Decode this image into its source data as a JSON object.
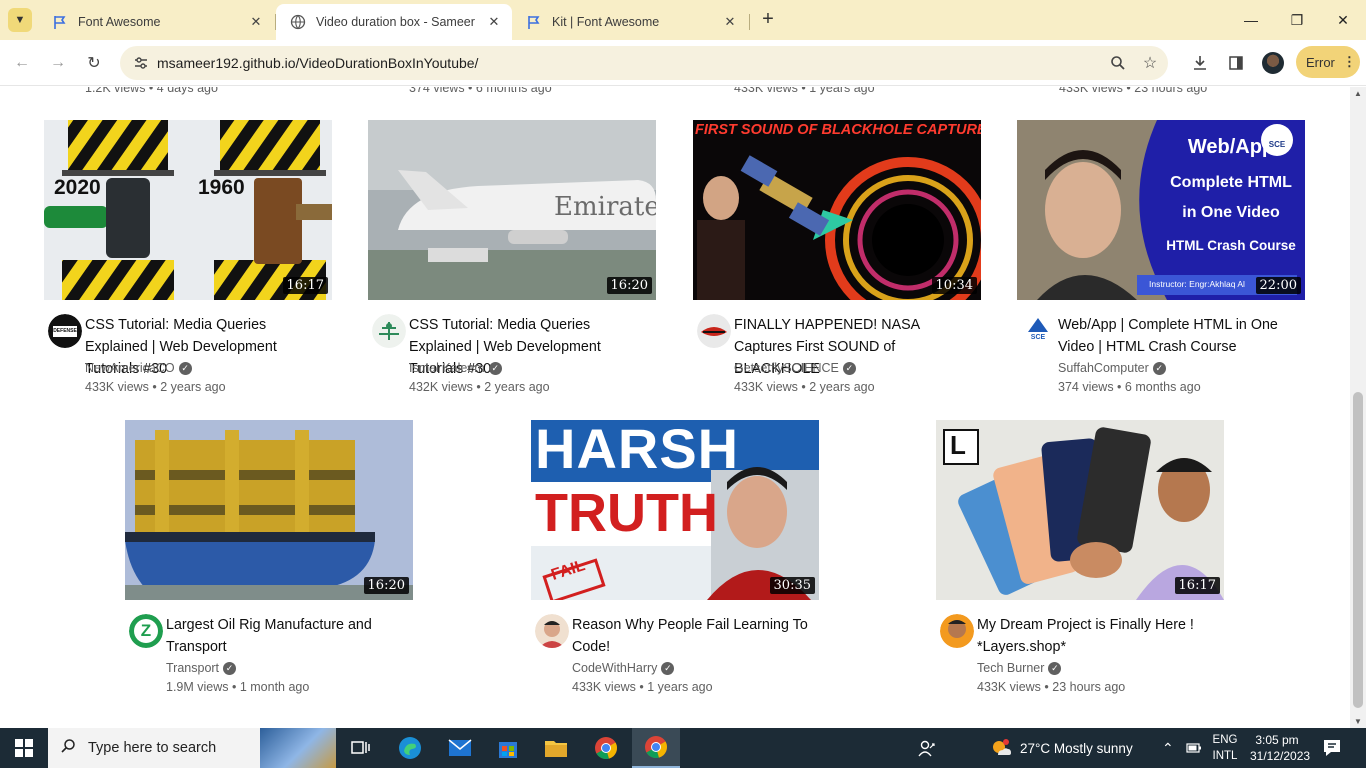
{
  "browser": {
    "tabs": [
      {
        "title": "Font Awesome",
        "active": false
      },
      {
        "title": "Video duration box - Sameer",
        "active": true
      },
      {
        "title": "Kit | Font Awesome",
        "active": false
      }
    ],
    "url": "msameer192.github.io/VideoDurationBoxInYoutube/",
    "profile_status": "Error"
  },
  "partial_row": [
    {
      "meta": "1.2K views • 4 days ago"
    },
    {
      "meta": "374 views • 6 months ago"
    },
    {
      "meta": "433K views • 1 years ago"
    },
    {
      "meta": "433K views • 23 hours ago"
    }
  ],
  "videos": [
    {
      "title": "CSS Tutorial: Media Queries Explained | Web Development Tutorials #30",
      "channel": "NewAmericaCO",
      "meta": "433K views • 2 years ago",
      "duration": "16:17",
      "thumb_text": [
        "2020",
        "1960"
      ]
    },
    {
      "title": "CSS Tutorial: Media Queries Explained | Web Development Tutorials #30",
      "channel": "Ismal Kaleem",
      "meta": "432K views • 2 years ago",
      "duration": "16:20",
      "thumb_text": [
        "Emirates"
      ]
    },
    {
      "title": "FINALLY HAPPENED! NASA Captures First SOUND of BLACKHOLE",
      "channel": "GetsetflySCIENCE",
      "meta": "433K views • 2 years ago",
      "duration": "10:34",
      "thumb_text": [
        "FIRST SOUND OF BLACKHOLE CAPTURED!"
      ]
    },
    {
      "title": "Web/App | Complete HTML in One Video | HTML Crash Course",
      "channel": "SuffahComputer",
      "meta": "374 views • 6 months ago",
      "duration": "22:00",
      "thumb_text": [
        "Web/App",
        "Complete HTML",
        "in One Video",
        "HTML Crash Course",
        "Instructor: Engr:Akhlaq Al",
        "SCE"
      ]
    },
    {
      "title": "Largest Oil Rig Manufacture and Transport",
      "channel": "Transport",
      "meta": "1.9M views • 1 month ago",
      "duration": "16:20",
      "thumb_text": []
    },
    {
      "title": "Reason Why People Fail Learning To Code!",
      "channel": "CodeWithHarry",
      "meta": "433K views • 1 years ago",
      "duration": "30:35",
      "thumb_text": [
        "HARSH",
        "TRUTH",
        "FAIL"
      ]
    },
    {
      "title": "My Dream Project is Finally Here ! *Layers.shop*",
      "channel": "Tech Burner",
      "meta": "433K views • 23 hours ago",
      "duration": "16:17",
      "thumb_text": [
        "L"
      ]
    }
  ],
  "channel_avatars": {
    "defense": "DEFENSE",
    "sce": "SCE",
    "transport": "Z"
  },
  "taskbar": {
    "search_placeholder": "Type here to search",
    "weather": "27°C  Mostly sunny",
    "lang_line1": "ENG",
    "lang_line2": "INTL",
    "time": "3:05 pm",
    "date": "31/12/2023"
  },
  "colors": {
    "tabstrip": "#f8eec7",
    "omnibox": "#f6f1df",
    "error_pill": "#f2d378",
    "taskbar": "#1c2b36"
  }
}
